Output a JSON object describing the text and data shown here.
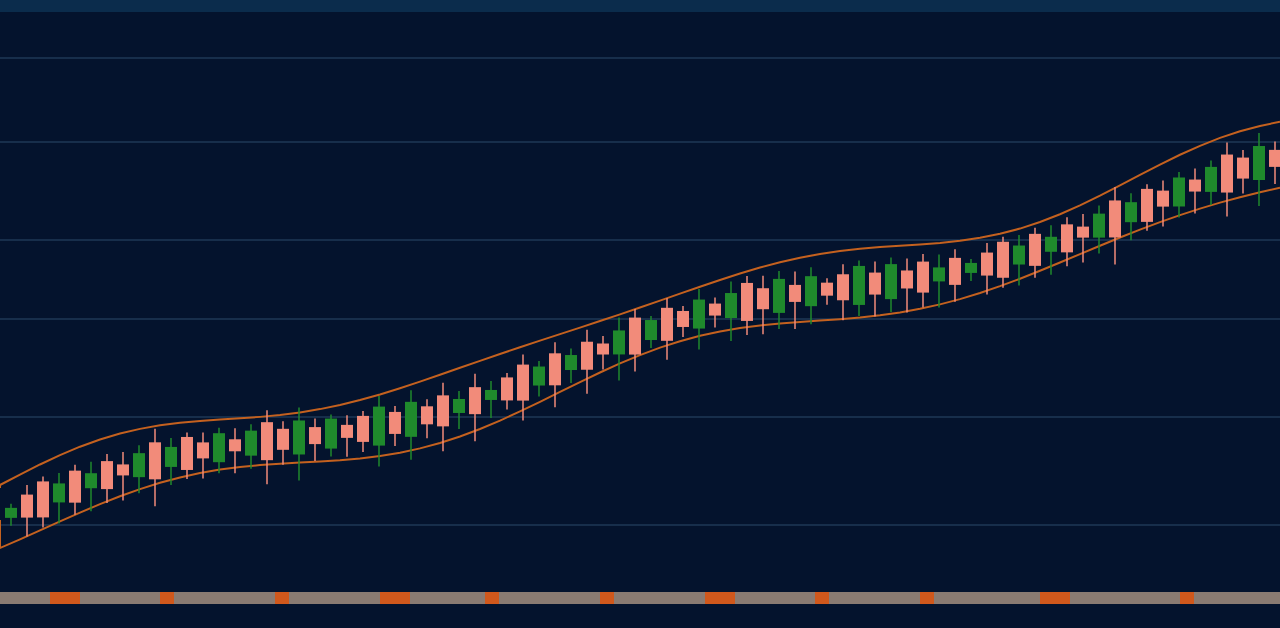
{
  "panels": [
    {
      "kind": "candlestick_chart"
    },
    {
      "kind": "timeline_bar"
    }
  ]
}
